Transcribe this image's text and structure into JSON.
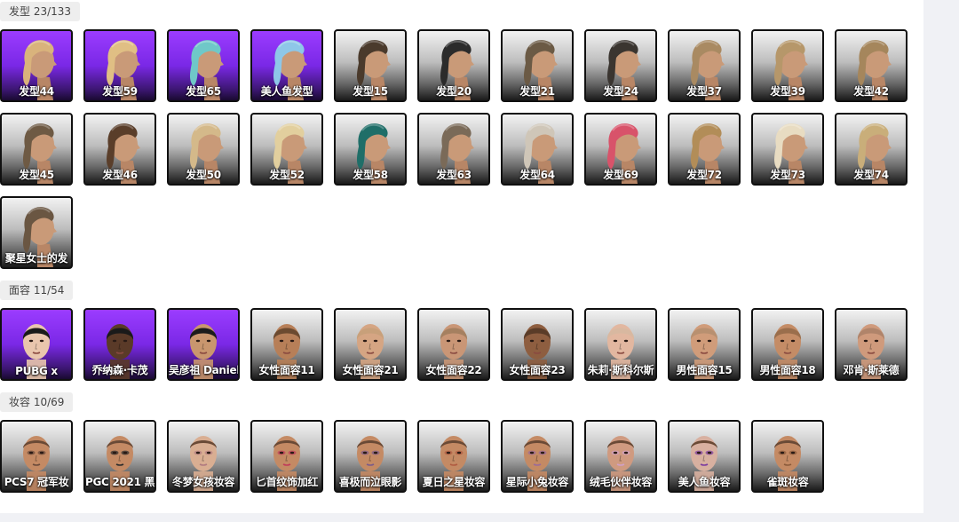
{
  "sections": [
    {
      "title": "发型 23/133",
      "kind": "hair",
      "items": [
        {
          "label": "发型44",
          "bg": "purple",
          "hair": "#d9b37c"
        },
        {
          "label": "发型59",
          "bg": "purple",
          "hair": "#e0bf84"
        },
        {
          "label": "发型65",
          "bg": "purple",
          "hair": "#6fc8c8"
        },
        {
          "label": "美人鱼发型",
          "bg": "purple",
          "hair": "#8ec7e8"
        },
        {
          "label": "发型15",
          "bg": "gray",
          "hair": "#4a3a2c"
        },
        {
          "label": "发型20",
          "bg": "gray",
          "hair": "#2b2b2b"
        },
        {
          "label": "发型21",
          "bg": "gray",
          "hair": "#6b5a45"
        },
        {
          "label": "发型24",
          "bg": "gray",
          "hair": "#3a3530"
        },
        {
          "label": "发型37",
          "bg": "gray",
          "hair": "#a98a62"
        },
        {
          "label": "发型39",
          "bg": "gray",
          "hair": "#b6976a"
        },
        {
          "label": "发型42",
          "bg": "gray",
          "hair": "#a5865c"
        },
        {
          "label": "发型45",
          "bg": "gray",
          "hair": "#6e5a44"
        },
        {
          "label": "发型46",
          "bg": "gray",
          "hair": "#5a3e2a"
        },
        {
          "label": "发型50",
          "bg": "gray",
          "hair": "#d4b98a"
        },
        {
          "label": "发型52",
          "bg": "gray",
          "hair": "#e2cf9e"
        },
        {
          "label": "发型58",
          "bg": "gray",
          "hair": "#1f6e68"
        },
        {
          "label": "发型63",
          "bg": "gray",
          "hair": "#7a6a58"
        },
        {
          "label": "发型64",
          "bg": "gray",
          "hair": "#cfc6b8"
        },
        {
          "label": "发型69",
          "bg": "gray",
          "hair": "#d8536a"
        },
        {
          "label": "发型72",
          "bg": "gray",
          "hair": "#b28d58"
        },
        {
          "label": "发型73",
          "bg": "gray",
          "hair": "#e8dcc2"
        },
        {
          "label": "发型74",
          "bg": "gray",
          "hair": "#c9ae7a"
        },
        {
          "label": "聚星女士的发",
          "bg": "gray",
          "hair": "#6a5642"
        }
      ]
    },
    {
      "title": "面容 11/54",
      "kind": "face",
      "items": [
        {
          "label": "PUBG x",
          "bg": "purple",
          "skin": "#e9c6ad",
          "hair": "#1a1a1a"
        },
        {
          "label": "乔纳森·卡茂",
          "bg": "purple",
          "skin": "#5a3a28",
          "hair": "#1a1a1a"
        },
        {
          "label": "吴彦祖 Daniel",
          "bg": "purple",
          "skin": "#c9966e",
          "hair": "#1c1c1c"
        },
        {
          "label": "女性面容11",
          "bg": "gray",
          "skin": "#b77f58",
          "hair": "#6b4a30"
        },
        {
          "label": "女性面容21",
          "bg": "gray",
          "skin": "#d5a583",
          "hair": "#c8a07a"
        },
        {
          "label": "女性面容22",
          "bg": "gray",
          "skin": "#c99676",
          "hair": "#a58060"
        },
        {
          "label": "女性面容23",
          "bg": "gray",
          "skin": "#8e5e40",
          "hair": "#5a3c28"
        },
        {
          "label": "朱莉·斯科尔斯",
          "bg": "gray",
          "skin": "#e2b7a0",
          "hair": "#d8b8a0"
        },
        {
          "label": "男性面容15",
          "bg": "gray",
          "skin": "#d09c7a",
          "hair": "#b89070"
        },
        {
          "label": "男性面容18",
          "bg": "gray",
          "skin": "#c48c66",
          "hair": "#9a6e4c"
        },
        {
          "label": "邓肯·斯莱德",
          "bg": "gray",
          "skin": "#cf9a7c",
          "hair": "#b0846a"
        }
      ]
    },
    {
      "title": "妆容 10/69",
      "kind": "makeup",
      "items": [
        {
          "label": "PCS7 冠军妆",
          "bg": "gray",
          "skin": "#c48a64",
          "accent": "#6a4a3a"
        },
        {
          "label": "PGC 2021 黑",
          "bg": "gray",
          "skin": "#c48a64",
          "accent": "#2a2a2a"
        },
        {
          "label": "冬梦女孩妆容",
          "bg": "gray",
          "skin": "#d9ae92",
          "accent": "#b07a80"
        },
        {
          "label": "匕首纹饰加红",
          "bg": "gray",
          "skin": "#c48a64",
          "accent": "#c03a5a"
        },
        {
          "label": "喜极而泣眼影",
          "bg": "gray",
          "skin": "#c48a64",
          "accent": "#7a5a8a"
        },
        {
          "label": "夏日之星妆容",
          "bg": "gray",
          "skin": "#c48a64",
          "accent": "#b05a40"
        },
        {
          "label": "星际小兔妆容",
          "bg": "gray",
          "skin": "#c48a64",
          "accent": "#9a6a9a"
        },
        {
          "label": "绒毛伙伴妆容",
          "bg": "gray",
          "skin": "#cf9a80",
          "accent": "#d0a0c8"
        },
        {
          "label": "美人鱼妆容",
          "bg": "gray",
          "skin": "#d8b0a0",
          "accent": "#7a3aa0"
        },
        {
          "label": "雀斑妆容",
          "bg": "gray",
          "skin": "#c48a64",
          "accent": "#8a5a3a"
        }
      ]
    }
  ]
}
